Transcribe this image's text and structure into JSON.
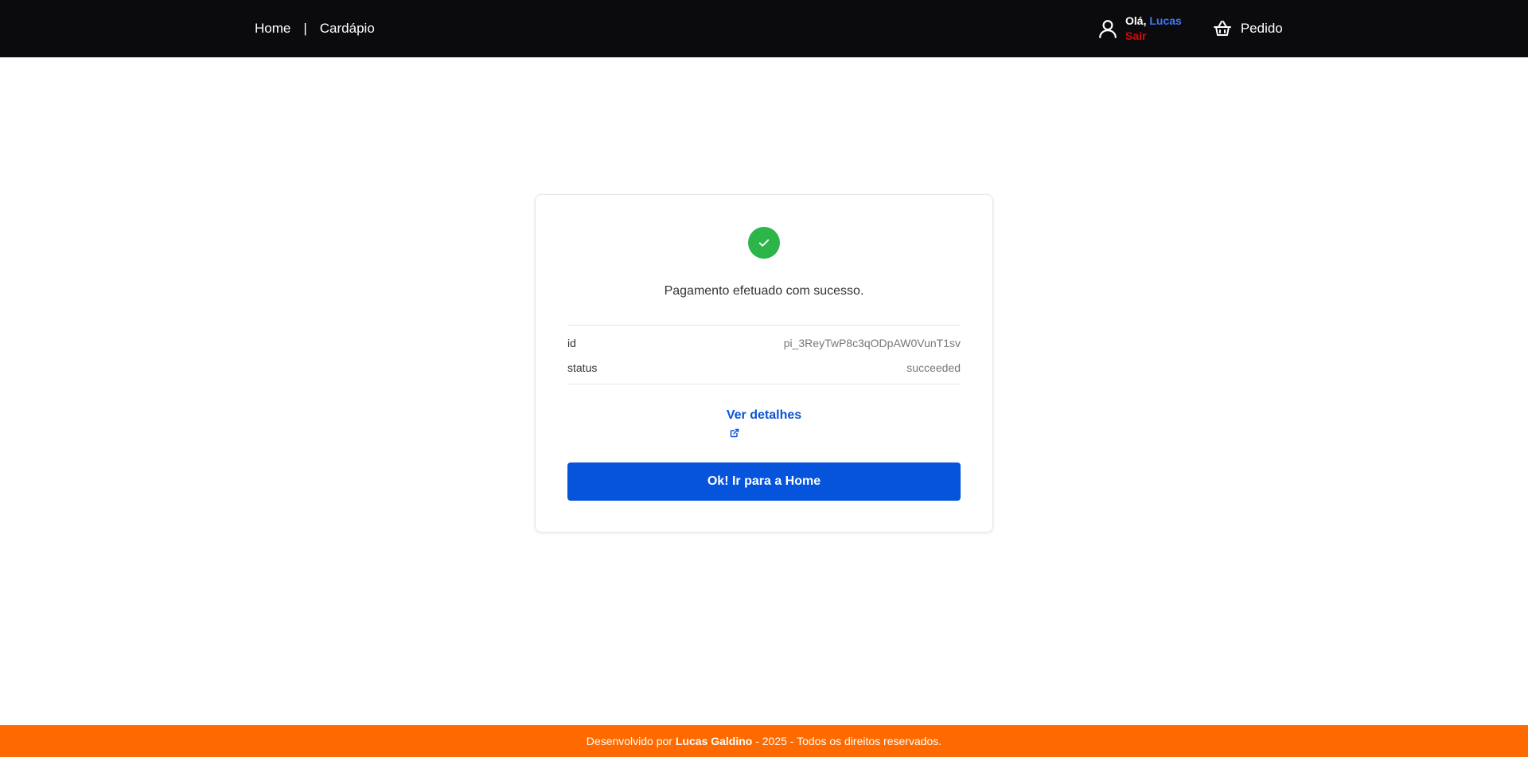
{
  "nav": {
    "home_label": "Home",
    "separator": "|",
    "menu_label": "Cardápio",
    "greeting": "Olá,",
    "user_name": "Lucas",
    "logout_label": "Sair",
    "order_label": "Pedido",
    "user_icon": "user-icon",
    "basket_icon": "basket-icon"
  },
  "payment": {
    "success_icon": "check-icon",
    "message": "Pagamento efetuado com sucesso.",
    "details": [
      {
        "key": "id",
        "value": "pi_3ReyTwP8c3qODpAW0VunT1sv"
      },
      {
        "key": "status",
        "value": "succeeded"
      }
    ],
    "details_link": "Ver detalhes",
    "external_icon": "external-link-icon",
    "button_label": "Ok! Ir para a Home"
  },
  "footer": {
    "prefix": "Desenvolvido por ",
    "author": "Lucas Galdino",
    "suffix": " - 2025 - Todos os direitos reservados."
  },
  "colors": {
    "navbar_bg": "#0b0b0d",
    "accent_blue": "#0653dc",
    "success_green": "#2db54a",
    "footer_orange": "#ff6a00",
    "logout_red": "#d40a0a"
  }
}
